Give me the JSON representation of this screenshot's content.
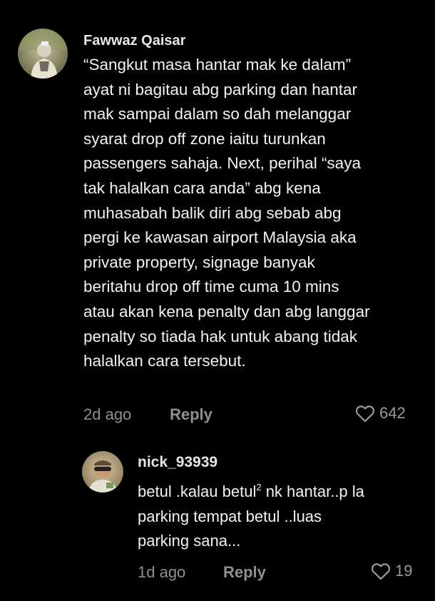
{
  "comments": [
    {
      "username": "Fawwaz Qaisar",
      "lines": [
        "“Sangkut masa hantar mak ke dalam”",
        "ayat ni bagitau abg parking dan hantar",
        "mak sampai dalam so dah melanggar",
        "syarat drop off zone iaitu turunkan",
        "passengers sahaja. Next, perihal “saya",
        "tak halalkan cara anda” abg kena",
        "muhasabah balik diri abg sebab abg",
        "pergi ke kawasan airport Malaysia aka",
        "private property, signage banyak",
        "beritahu drop off time cuma 10 mins",
        "atau akan kena penalty dan abg langgar",
        "penalty so tiada hak untuk abang tidak",
        "halalkan cara tersebut."
      ],
      "timestamp": "2d ago",
      "reply_label": "Reply",
      "like_count": "642"
    }
  ],
  "reply": {
    "username": "nick_93939",
    "line1_pre": "betul .kalau betul",
    "line1_sup": "2",
    "line1_post": " nk hantar..p la",
    "line2": "parking tempat betul ..luas",
    "line3": "parking sana...",
    "timestamp": "1d ago",
    "reply_label": "Reply",
    "like_count": "19"
  },
  "icons": {
    "like": "heart-outline-icon"
  }
}
